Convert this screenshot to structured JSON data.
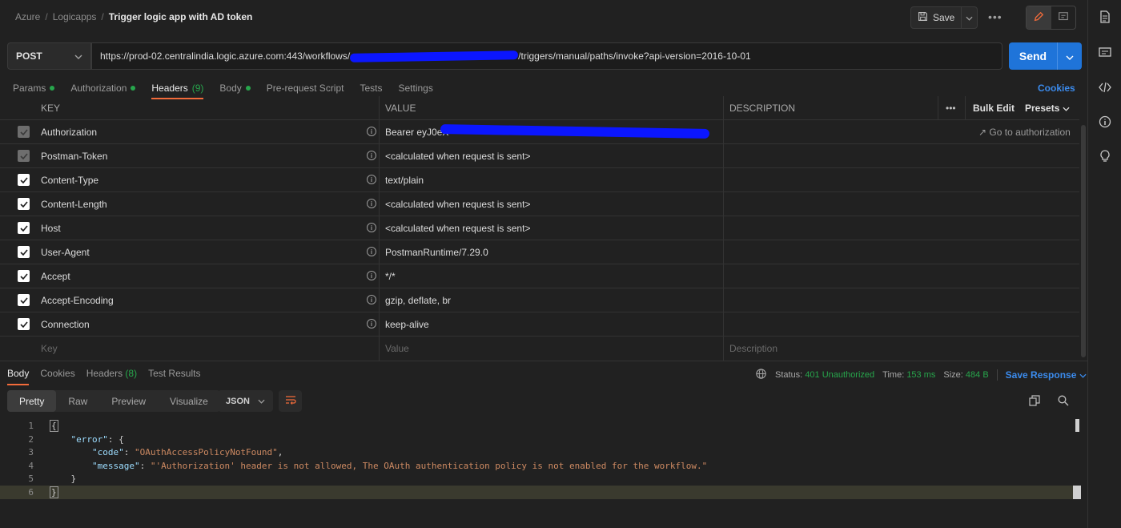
{
  "breadcrumb": {
    "items": [
      "Azure",
      "Logicapps"
    ],
    "separator": "/",
    "current": "Trigger logic app with AD token"
  },
  "toolbar": {
    "save_label": "Save",
    "more_label": "•••"
  },
  "request": {
    "method": "POST",
    "url_prefix": "https://prod-02.centralindia.logic.azure.com:443/workflows/",
    "url_suffix": "/triggers/manual/paths/invoke?api-version=2016-10-01",
    "send_label": "Send"
  },
  "req_tabs": [
    {
      "label": "Params",
      "dot": true
    },
    {
      "label": "Authorization",
      "dot": true
    },
    {
      "label": "Headers",
      "count": "(9)",
      "active": true
    },
    {
      "label": "Body",
      "dot": true
    },
    {
      "label": "Pre-request Script"
    },
    {
      "label": "Tests"
    },
    {
      "label": "Settings"
    }
  ],
  "cookies_label": "Cookies",
  "headers_table": {
    "columns": {
      "key": "KEY",
      "value": "VALUE",
      "description": "DESCRIPTION"
    },
    "more_label": "•••",
    "bulk_edit": "Bulk Edit",
    "presets": "Presets",
    "rows": [
      {
        "key": "Authorization",
        "value": "Bearer eyJ0eX",
        "disabled": true,
        "extra": "Go to authorization"
      },
      {
        "key": "Postman-Token",
        "value": "<calculated when request is sent>",
        "disabled": true
      },
      {
        "key": "Content-Type",
        "value": "text/plain"
      },
      {
        "key": "Content-Length",
        "value": "<calculated when request is sent>"
      },
      {
        "key": "Host",
        "value": "<calculated when request is sent>"
      },
      {
        "key": "User-Agent",
        "value": "PostmanRuntime/7.29.0"
      },
      {
        "key": "Accept",
        "value": "*/*"
      },
      {
        "key": "Accept-Encoding",
        "value": "gzip, deflate, br"
      },
      {
        "key": "Connection",
        "value": "keep-alive"
      }
    ],
    "new_row": {
      "key": "Key",
      "value": "Value",
      "description": "Description"
    }
  },
  "response": {
    "tabs": [
      {
        "label": "Body",
        "active": true
      },
      {
        "label": "Cookies"
      },
      {
        "label": "Headers",
        "count": "(8)"
      },
      {
        "label": "Test Results"
      }
    ],
    "status_label": "Status:",
    "status_value": "401 Unauthorized",
    "time_label": "Time:",
    "time_value": "153 ms",
    "size_label": "Size:",
    "size_value": "484 B",
    "save_response": "Save Response",
    "view_tabs": [
      "Pretty",
      "Raw",
      "Preview",
      "Visualize"
    ],
    "format": "JSON",
    "code_lines": [
      {
        "n": "1",
        "text": "{"
      },
      {
        "n": "2",
        "key": "\"error\"",
        "rest": ": {"
      },
      {
        "n": "3",
        "key": "\"code\"",
        "rest": ": ",
        "str": "\"OAuthAccessPolicyNotFound\"",
        "tail": ","
      },
      {
        "n": "4",
        "key": "\"message\"",
        "rest": ": ",
        "str": "\"'Authorization' header is not allowed, The OAuth authentication policy is not enabled for the workflow.\""
      },
      {
        "n": "5",
        "text": "}"
      },
      {
        "n": "6",
        "text": "}"
      }
    ]
  },
  "colors": {
    "accent": "#f26b3a",
    "send": "#1f74d9",
    "green": "#27a64c",
    "link": "#3b8bed"
  }
}
